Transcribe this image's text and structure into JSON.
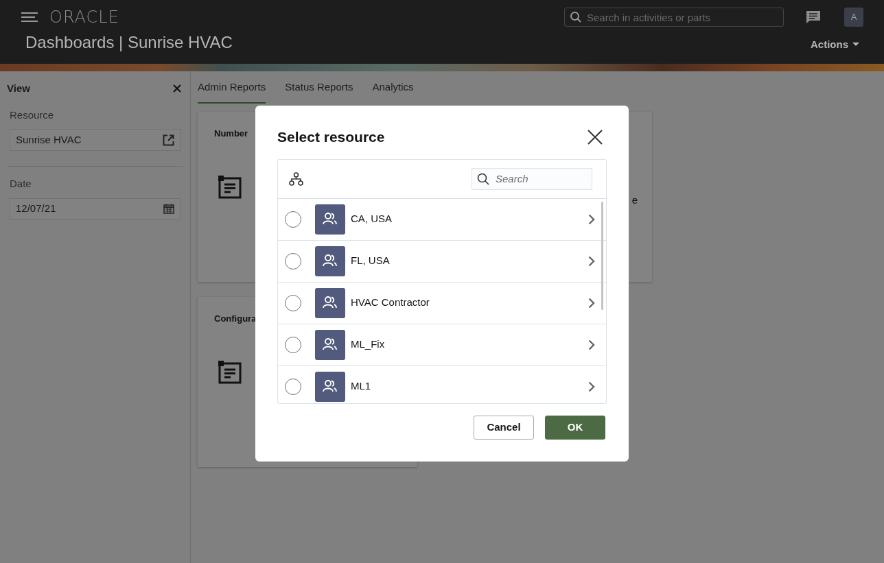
{
  "header": {
    "logo": "ORACLE",
    "search": {
      "placeholder": "Search in activities or parts"
    },
    "avatar": "A",
    "title": "Dashboards | Sunrise HVAC",
    "actions": "Actions"
  },
  "sidebar": {
    "title": "View",
    "fields": [
      {
        "kind": "link",
        "label": "Resource",
        "value": "Sunrise HVAC"
      },
      {
        "kind": "date",
        "label": "Date",
        "value": "12/07/21"
      }
    ]
  },
  "tabs": [
    {
      "label": "Admin Reports",
      "selected": true
    },
    {
      "label": "Status Reports",
      "selected": false
    },
    {
      "label": "Analytics",
      "selected": false
    }
  ],
  "cards": [
    {
      "title": "Number",
      "fragment": "e"
    },
    {
      "title": "Configura"
    }
  ],
  "dialog": {
    "title": "Select resource",
    "search": {
      "placeholder": "Search"
    },
    "rows": [
      {
        "label": "CA, USA",
        "selected": false
      },
      {
        "label": "FL, USA",
        "selected": false
      },
      {
        "label": "HVAC Contractor",
        "selected": false
      },
      {
        "label": "ML_Fix",
        "selected": false
      },
      {
        "label": "ML1",
        "selected": false
      }
    ],
    "buttons": [
      {
        "kind": "secondary",
        "label": "Cancel"
      },
      {
        "kind": "primary",
        "label": "OK"
      }
    ]
  }
}
